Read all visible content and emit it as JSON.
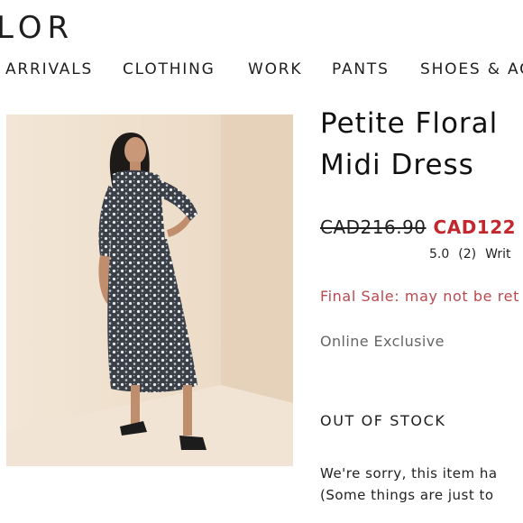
{
  "header": {
    "logo_text": "LOR"
  },
  "nav": {
    "items": [
      {
        "label": "ARRIVALS"
      },
      {
        "label": "CLOTHING"
      },
      {
        "label": "WORK"
      },
      {
        "label": "PANTS"
      },
      {
        "label": "SHOES & AC"
      }
    ]
  },
  "product": {
    "title_line1": "Petite Floral",
    "title_line2": "Midi Dress",
    "price_original": "CAD216.90",
    "price_sale": "CAD122",
    "rating_value": "5.0",
    "rating_count": "(2)",
    "write_review_label": "Writ",
    "final_sale_text": "Final Sale: may not be ret",
    "online_exclusive_text": "Online Exclusive",
    "stock_status": "OUT OF STOCK",
    "sorry_line1": "We're sorry, this item ha",
    "sorry_line2": "(Some things are just to"
  },
  "colors": {
    "sale_red": "#c1272d",
    "final_sale_red": "#b64a4f",
    "image_background": "#ecdcc9",
    "text": "#222222"
  }
}
